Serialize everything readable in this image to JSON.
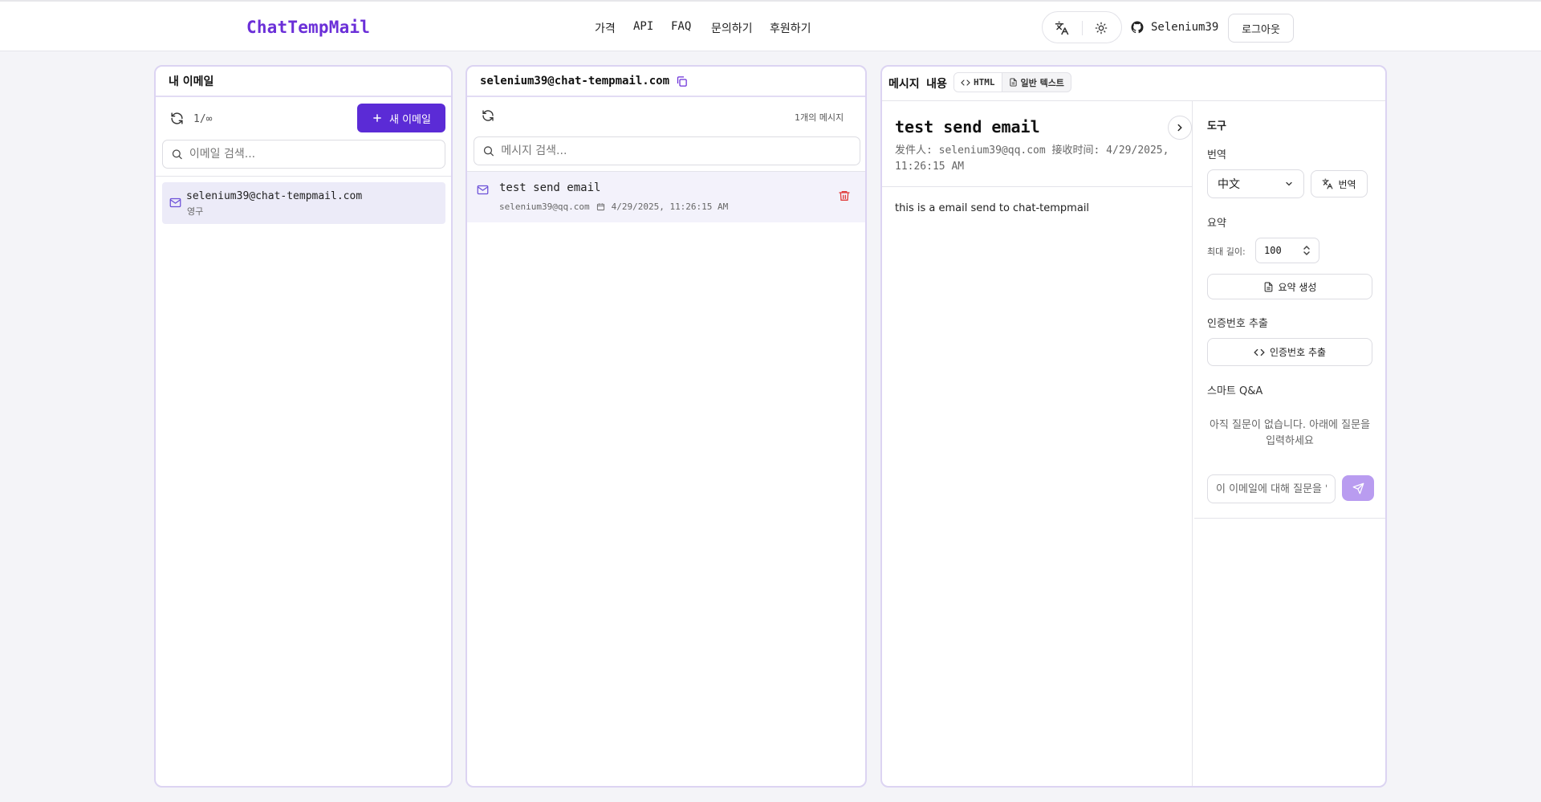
{
  "header": {
    "logo": "ChatTempMail",
    "nav": [
      "가격",
      "API",
      "FAQ",
      "문의하기",
      "후원하기"
    ],
    "username": "Selenium39",
    "logout_label": "로그아웃"
  },
  "mailbox_panel": {
    "title": "내 이메일",
    "count": "1/∞",
    "new_email_label": "새 이메일",
    "search_placeholder": "이메일 검색...",
    "emails": [
      {
        "address": "selenium39@chat-tempmail.com",
        "type": "영구"
      }
    ]
  },
  "inbox_panel": {
    "address": "selenium39@chat-tempmail.com",
    "message_count": "1개의 메시지",
    "search_placeholder": "메시지 검색...",
    "messages": [
      {
        "subject": "test send email",
        "from": "selenium39@qq.com",
        "date": "4/29/2025, 11:26:15 AM"
      }
    ]
  },
  "message_panel": {
    "title": "메시지 내용",
    "tab_html": "HTML",
    "tab_text": "일반 텍스트",
    "subject": "test send email",
    "from_line": "发件人: selenium39@qq.com 接收时间: 4/29/2025, 11:26:15 AM",
    "body": "this is a email send to chat-tempmail"
  },
  "tools": {
    "title": "도구",
    "translate_label": "번역",
    "language": "中文",
    "translate_button": "번역",
    "summary_label": "요약",
    "max_length_label": "최대 길이:",
    "max_length_value": "100",
    "summary_button": "요약 생성",
    "code_label": "인증번호 추출",
    "code_button": "인증번호 추출",
    "qa_label": "스마트 Q&A",
    "qa_empty": "아직 질문이 없습니다. 아래에 질문을 입력하세요",
    "qa_placeholder": "이 이메일에 대해 질문을 입력하세요"
  },
  "colors": {
    "accent": "#5b2bd6",
    "logo": "#6b2fd8",
    "panel_border": "#dcd4f2",
    "delete": "#e03b3b"
  }
}
